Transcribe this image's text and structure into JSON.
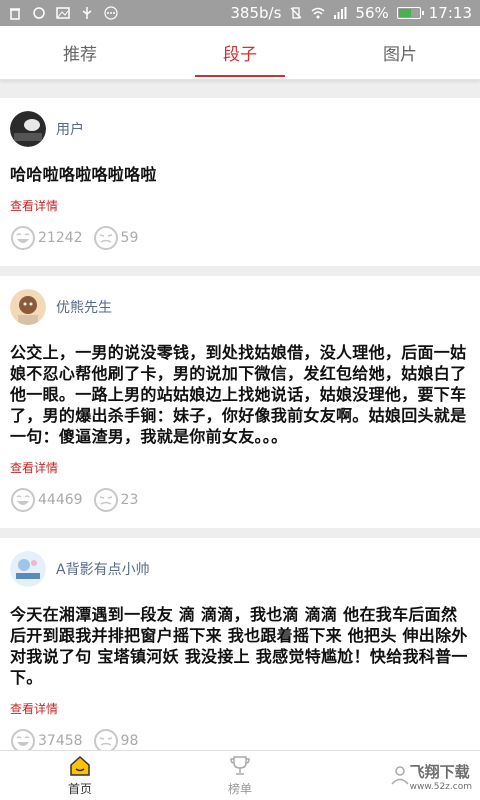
{
  "status_bar": {
    "network_speed": "385b/s",
    "battery_percent": "56%",
    "battery_level": 0.56,
    "time": "17:13"
  },
  "tabs": [
    {
      "label": "推荐",
      "active": false
    },
    {
      "label": "段子",
      "active": true
    },
    {
      "label": "图片",
      "active": false
    }
  ],
  "posts": [
    {
      "username": "用户",
      "content": "哈哈啦咯啦咯啦咯啦",
      "detail_label": "查看详情",
      "likes": "21242",
      "dislikes": "59"
    },
    {
      "username": "优熊先生",
      "content": "公交上，一男的说没零钱，到处找姑娘借，没人理他，后面一姑娘不忍心帮他刷了卡，男的说加下微信，发红包给她，姑娘白了他一眼。一路上男的站姑娘边上找她说话，姑娘没理他，要下车了，男的爆出杀手锏：妹子，你好像我前女友啊。姑娘回头就是一句：傻逼渣男，我就是你前女友。。。",
      "detail_label": "查看详情",
      "likes": "44469",
      "dislikes": "23"
    },
    {
      "username": "A背影有点小帅",
      "content": "今天在湘潭遇到一段友 滴 滴滴，我也滴 滴滴 他在我车后面然后开到跟我并排把窗户摇下来 我也跟着摇下来 他把头 伸出除外 对我说了句 宝塔镇河妖 我没接上 我感觉特尴尬！快给我科普一下。",
      "detail_label": "查看详情",
      "likes": "37458",
      "dislikes": "98"
    }
  ],
  "bottom_nav": [
    {
      "label": "首页",
      "icon": "home-icon",
      "active": true
    },
    {
      "label": "榜单",
      "icon": "trophy-icon",
      "active": false
    },
    {
      "label": "",
      "icon": "profile-icon",
      "active": false
    }
  ],
  "watermark": {
    "text": "飞翔下载",
    "sub": "www.52z.com"
  },
  "colors": {
    "accent": "#d32f2f",
    "status_bar": "#9e9e9e",
    "username": "#5a6a8a",
    "battery": "#4caf50"
  }
}
